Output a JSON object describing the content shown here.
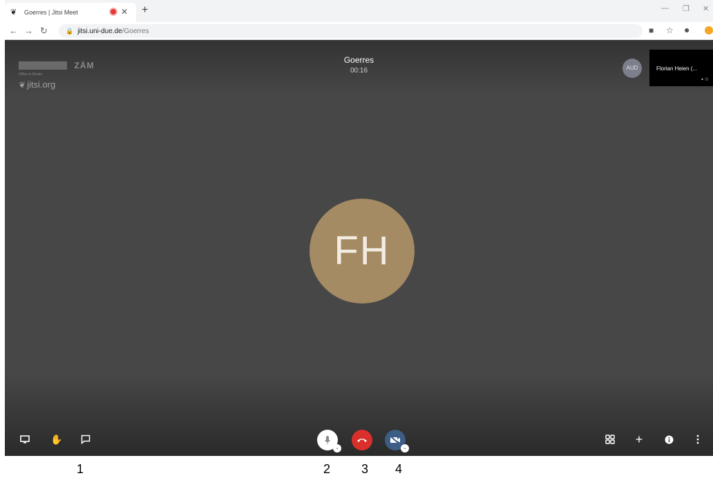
{
  "browser": {
    "tab_title": "Goerres | Jitsi Meet",
    "url_domain": "jitsi.uni-due.de",
    "url_path": "/Goerres"
  },
  "watermark": {
    "zam": "ZÄM",
    "office": "Office in Dexter",
    "jitsi": "jitsi.org"
  },
  "meeting": {
    "room_name": "Goerres",
    "timer": "00:16",
    "aud_initials": "AUD",
    "thumbnail_name": "Florian Heien (...",
    "avatar_initials": "FH"
  },
  "annotations": [
    "1",
    "2",
    "3",
    "4"
  ],
  "colors": {
    "meeting_bg": "#474747",
    "avatar_bg": "#a58b64",
    "hangup": "#d9302c",
    "camera_button": "#3c5d84"
  }
}
